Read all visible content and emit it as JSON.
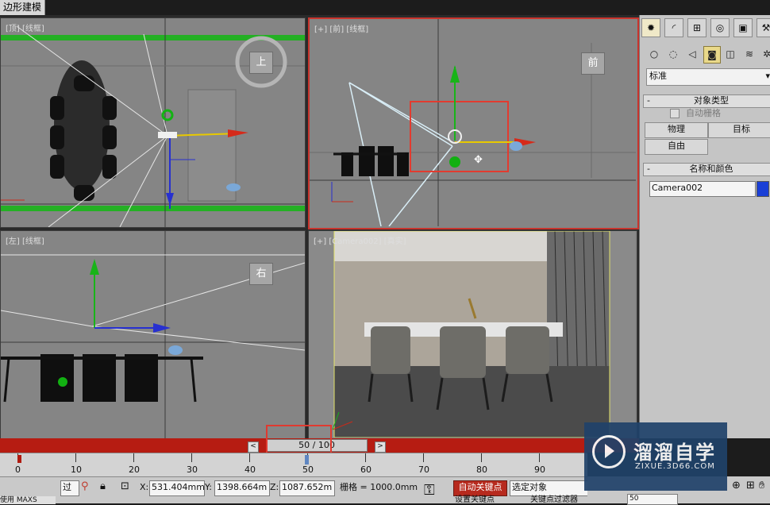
{
  "app": {
    "title": "边形建模"
  },
  "viewports": {
    "top": {
      "label": "[顶] [线框]",
      "cube_label": "上"
    },
    "front": {
      "label": "[+] [前] [线框]",
      "cube_label": "前"
    },
    "left": {
      "label": "[左] [线框]",
      "cube_label": "右"
    },
    "camera": {
      "label": "[+] [Camera002] [真实]"
    }
  },
  "command_panel": {
    "tabs": [
      "create-icon",
      "modify-icon",
      "hierarchy-icon",
      "motion-icon",
      "display-icon",
      "utilities-icon"
    ],
    "category_dropdown": "标准",
    "object_type": {
      "title": "对象类型",
      "autogrid_label": "自动栅格",
      "buttons": [
        "物理",
        "目标",
        "自由"
      ]
    },
    "name_color": {
      "title": "名称和颜色",
      "name_value": "Camera002",
      "swatch_color": "#1a3fd6"
    }
  },
  "timeline": {
    "frame_display": "50 / 100",
    "prev": "<",
    "next": ">",
    "ruler_numbers": [
      "0",
      "10",
      "20",
      "30",
      "40",
      "50",
      "60",
      "70",
      "80",
      "90"
    ]
  },
  "status": {
    "left_partial_1": "过",
    "left_partial_2": "使用 MAXS",
    "x_label": "X:",
    "x_value": "531.404mm",
    "y_label": "Y:",
    "y_value": "1398.664m",
    "z_label": "Z:",
    "z_value": "1087.652m",
    "grid": "栅格 = 1000.0mm",
    "autokey": "自动关键点",
    "selected": "选定对象",
    "setkey_partial": "设置关键点",
    "filter_partial": "关键点过滤器",
    "frame_field": "50"
  },
  "logo": {
    "name": "溜溜自学",
    "url": "ZIXUE.3D66.COM"
  },
  "colors": {
    "autokey_red": "#b72a1e",
    "timeline_red": "#b61c12",
    "active_border": "#c8342d"
  }
}
